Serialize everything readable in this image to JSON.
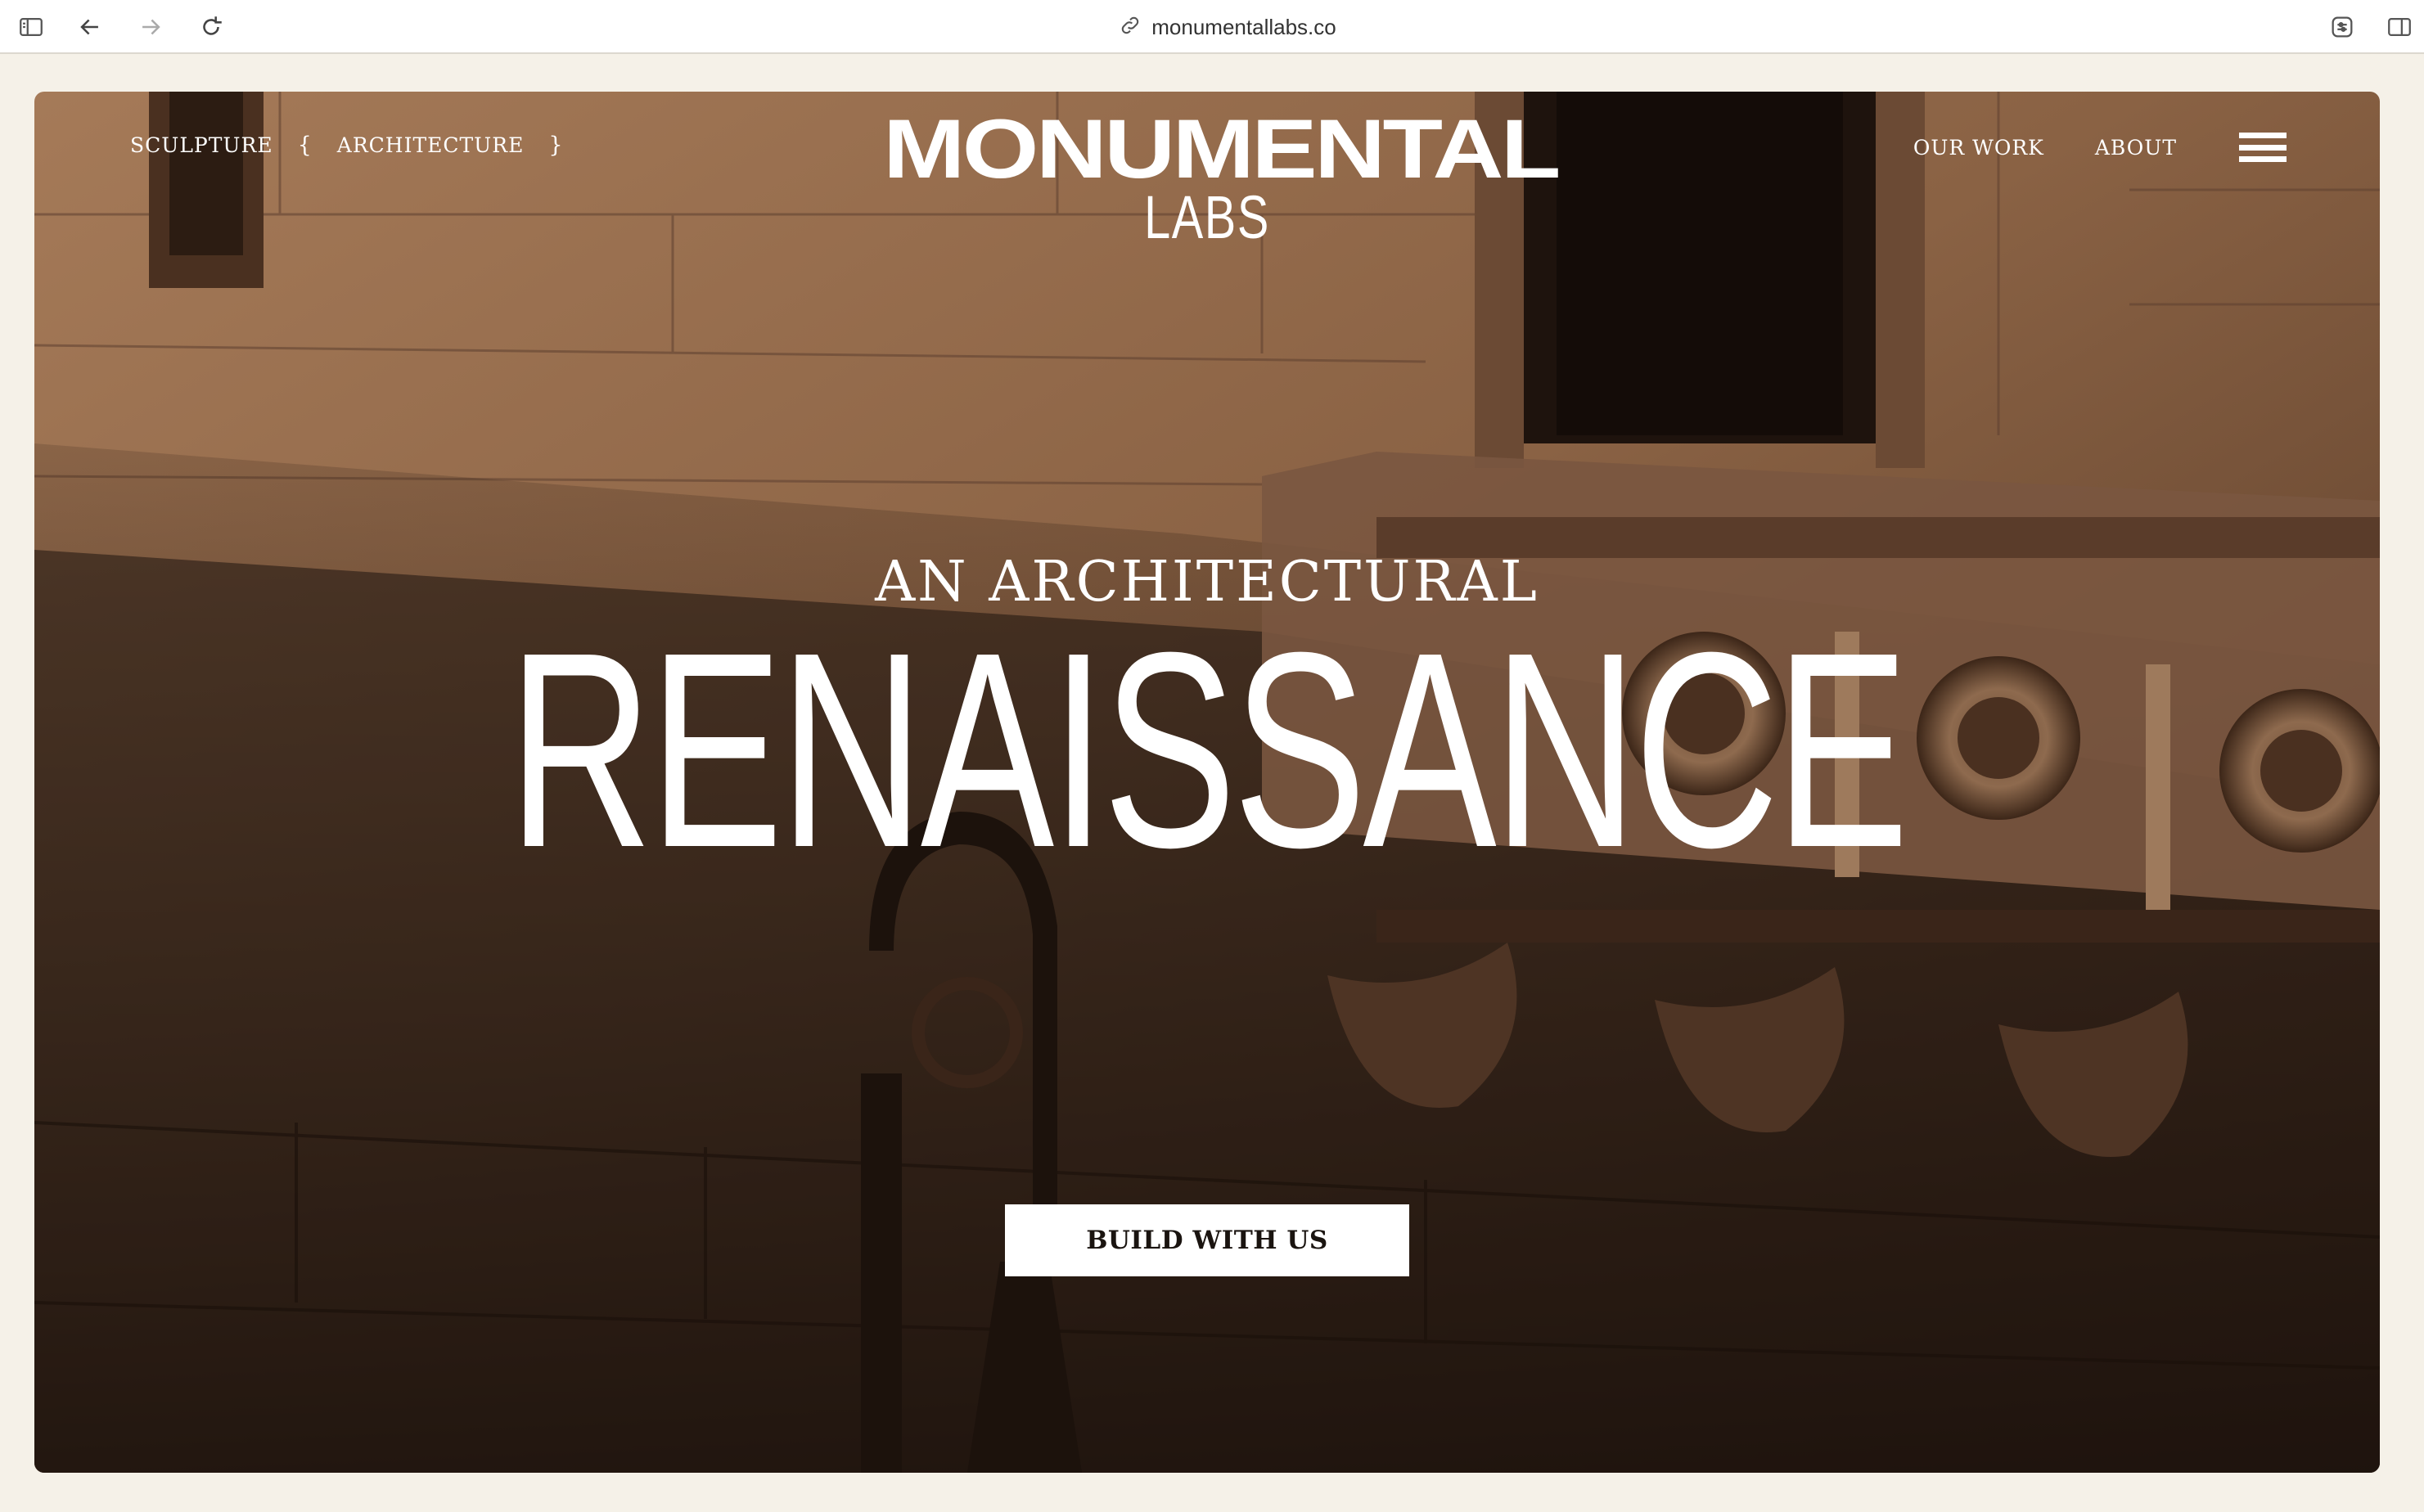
{
  "browser": {
    "url": "monumentallabs.co",
    "icons": [
      "sidebar-icon",
      "back-icon",
      "forward-icon",
      "reload-icon",
      "link-icon",
      "extension-icon",
      "split-view-icon"
    ]
  },
  "nav": {
    "left": [
      "SCULPTURE",
      "{",
      "ARCHITECTURE",
      "}"
    ],
    "right": [
      "OUR WORK",
      "ABOUT"
    ],
    "menu_icon": "hamburger-icon"
  },
  "logo": {
    "main": "MONUMENTAL",
    "sub": "LABS"
  },
  "hero": {
    "kicker": "AN ARCHITECTURAL",
    "headline": "RENAISSANCE",
    "cta": "BUILD WITH US"
  },
  "colors": {
    "page_bg": "#f5f1e8",
    "stone_light": "#a57a58",
    "stone_mid": "#7b563b",
    "stone_dark": "#2a1a12",
    "text": "#ffffff",
    "cta_text": "#1a1410"
  }
}
